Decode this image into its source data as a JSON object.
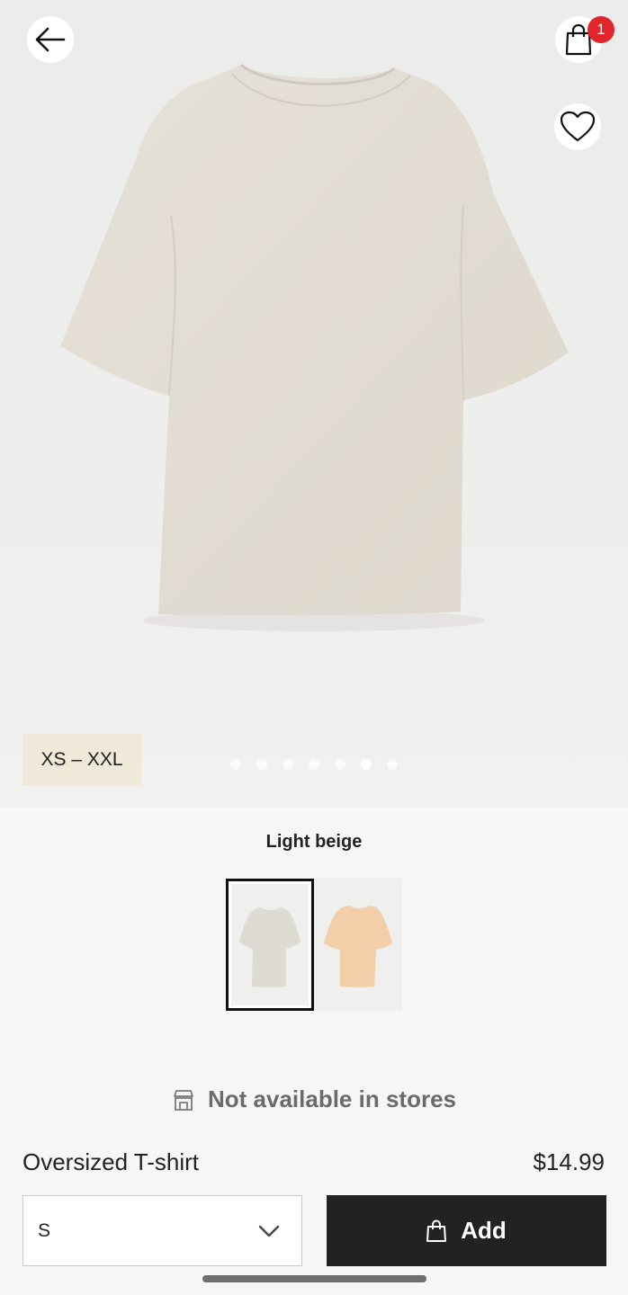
{
  "header": {
    "back_icon": "arrow-left-icon",
    "bag_icon": "shopping-bag-icon",
    "bag_count": "1",
    "favorite_icon": "heart-icon"
  },
  "gallery": {
    "size_range": "XS – XXL",
    "image_count": 7,
    "active_index": 5
  },
  "product": {
    "color_name": "Light beige",
    "swatches": [
      {
        "name": "Light beige",
        "hex": "#dedbd2",
        "selected": true
      },
      {
        "name": "Apricot",
        "hex": "#f3cfa9",
        "selected": false
      }
    ],
    "store_icon": "store-icon",
    "availability": "Not available in stores",
    "name": "Oversized T-shirt",
    "price": "$14.99"
  },
  "purchase": {
    "selected_size": "S",
    "dropdown_icon": "chevron-down-icon",
    "add_icon": "shopping-bag-icon",
    "add_label": "Add"
  },
  "colors": {
    "badge": "#e2252b",
    "button": "#222222",
    "chip": "#f0e8d8"
  }
}
